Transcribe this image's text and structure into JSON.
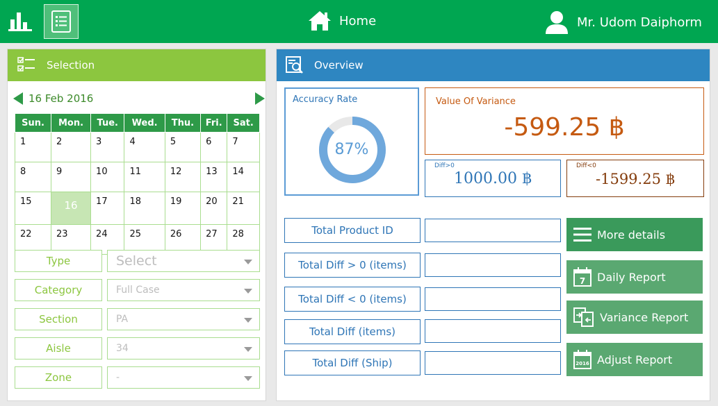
{
  "topbar": {
    "home_label": "Home",
    "user_name": "Mr. Udom Daiphorm"
  },
  "selection": {
    "title": "Selection",
    "month_label": "16 Feb 2016",
    "weekdays": [
      "Sun.",
      "Mon.",
      "Tue.",
      "Wed.",
      "Thu.",
      "Fri.",
      "Sat."
    ],
    "weeks": [
      [
        "1",
        "2",
        "3",
        "4",
        "5",
        "6",
        "7"
      ],
      [
        "8",
        "9",
        "10",
        "11",
        "12",
        "13",
        "14"
      ],
      [
        "15",
        "16",
        "17",
        "18",
        "19",
        "20",
        "21"
      ],
      [
        "22",
        "23",
        "24",
        "25",
        "26",
        "27",
        "28"
      ]
    ],
    "selected_day": "16",
    "filters": [
      {
        "label": "Type",
        "value": "Select"
      },
      {
        "label": "Category",
        "value": "Full Case"
      },
      {
        "label": "Section",
        "value": "PA"
      },
      {
        "label": "Aisle",
        "value": "34"
      },
      {
        "label": "Zone",
        "value": "-"
      }
    ]
  },
  "overview": {
    "title": "Overview",
    "accuracy": {
      "label": "Accuracy Rate",
      "value_text": "87%",
      "value": 87
    },
    "variance": {
      "label": "Value Of Variance",
      "value": "-599.25 ฿"
    },
    "diff_pos": {
      "label": "Diff>0",
      "value": "1000.00 ฿"
    },
    "diff_neg": {
      "label": "Diff<0",
      "value": "-1599.25 ฿"
    },
    "metrics": [
      {
        "label": "Total Product ID"
      },
      {
        "label": "Total Diff > 0 (items)"
      },
      {
        "label": "Total Diff < 0 (items)"
      },
      {
        "label": "Total Diff (items)"
      },
      {
        "label": "Total Diff (Ship)"
      }
    ],
    "actions": {
      "more_details": "More details",
      "daily_report": "Daily Report",
      "daily_icon_num": "7",
      "variance_report": "Variance Report",
      "adjust_report": "Adjust Report",
      "adjust_icon_year": "2016"
    }
  },
  "colors": {
    "green": "#00a651",
    "light_green": "#8cc63f",
    "blue": "#2e86c1",
    "orange": "#c55a11"
  }
}
